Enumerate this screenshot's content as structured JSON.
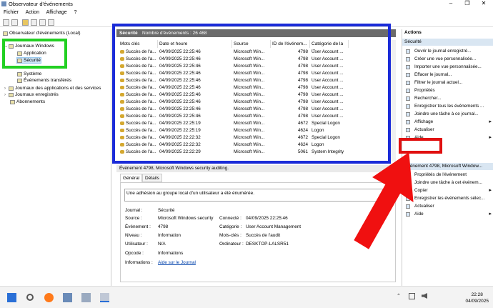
{
  "window": {
    "title": "Observateur d'événements",
    "controls": [
      "–",
      "❐",
      "✕"
    ]
  },
  "menu": [
    "Fichier",
    "Action",
    "Affichage",
    "?"
  ],
  "tree": {
    "root": "Observateur d'événements (Local)",
    "windows_logs": "Journaux Windows",
    "application": "Application",
    "security": "Sécurité",
    "system": "Système",
    "forwarded": "Événements transférés",
    "apps_services": "Journaux des applications et des services",
    "saved": "Journaux enregistrés",
    "subscriptions": "Abonnements"
  },
  "header": {
    "log": "Sécurité",
    "count": "Nombre d'événements : 26 468"
  },
  "columns": [
    "Mots clés",
    "Date et heure",
    "Source",
    "ID de l'événem...",
    "Catégorie de la ..."
  ],
  "rows": [
    [
      "Succès de l'a...",
      "04/09/2025 22:25:46",
      "Microsoft Win...",
      "4798",
      "User Account ..."
    ],
    [
      "Succès de l'a...",
      "04/09/2025 22:25:46",
      "Microsoft Win...",
      "4798",
      "User Account ..."
    ],
    [
      "Succès de l'a...",
      "04/09/2025 22:25:46",
      "Microsoft Win...",
      "4798",
      "User Account ..."
    ],
    [
      "Succès de l'a...",
      "04/09/2025 22:25:46",
      "Microsoft Win...",
      "4798",
      "User Account ..."
    ],
    [
      "Succès de l'a...",
      "04/09/2025 22:25:46",
      "Microsoft Win...",
      "4798",
      "User Account ..."
    ],
    [
      "Succès de l'a...",
      "04/09/2025 22:25:46",
      "Microsoft Win...",
      "4798",
      "User Account ..."
    ],
    [
      "Succès de l'a...",
      "04/09/2025 22:25:46",
      "Microsoft Win...",
      "4798",
      "User Account ..."
    ],
    [
      "Succès de l'a...",
      "04/09/2025 22:25:46",
      "Microsoft Win...",
      "4798",
      "User Account ..."
    ],
    [
      "Succès de l'a...",
      "04/09/2025 22:25:46",
      "Microsoft Win...",
      "4798",
      "User Account ..."
    ],
    [
      "Succès de l'a...",
      "04/09/2025 22:25:46",
      "Microsoft Win...",
      "4798",
      "User Account ..."
    ],
    [
      "Succès de l'a...",
      "04/09/2025 22:25:19",
      "Microsoft Win...",
      "4672",
      "Special Logon"
    ],
    [
      "Succès de l'a...",
      "04/09/2025 22:25:19",
      "Microsoft Win...",
      "4624",
      "Logon"
    ],
    [
      "Succès de l'a...",
      "04/09/2025 22:22:32",
      "Microsoft Win...",
      "4672",
      "Special Logon"
    ],
    [
      "Succès de l'a...",
      "04/09/2025 22:22:32",
      "Microsoft Win...",
      "4624",
      "Logon"
    ],
    [
      "Succès de l'a...",
      "04/09/2025 22:22:29",
      "Microsoft Win...",
      "5061",
      "System Integrity"
    ]
  ],
  "event_header": "Événement 4798, Microsoft Windows security auditing.",
  "tabs": [
    "Général",
    "Détails"
  ],
  "detail": {
    "message": "Une adhésion au groupe local d'un utilisateur a été énumérée.",
    "journal_lbl": "Journal :",
    "journal": "Sécurité",
    "source_lbl": "Source :",
    "source": "Microsoft Windows security",
    "connecte_lbl": "Connecté :",
    "connecte": "04/09/2025 22:25:46",
    "evenement_lbl": "Événement :",
    "evenement": "4798",
    "categorie_lbl": "Catégorie :",
    "categorie": "User Account Management",
    "niveau_lbl": "Niveau :",
    "niveau": "Information",
    "motscles_lbl": "Mots-clés :",
    "motscles": "Succès de l'audit",
    "utilisateur_lbl": "Utilisateur :",
    "utilisateur": "N/A",
    "ordinateur_lbl": "Ordinateur :",
    "ordinateur": "DESKTOP-LALSR51",
    "opcode_lbl": "Opcode :",
    "opcode": "Informations",
    "info_lbl": "Informations :",
    "info_link": "Aide sur le Journal"
  },
  "actions": {
    "title": "Actions",
    "section1": "Sécurité",
    "items1": [
      "Ouvrir le journal enregistré...",
      "Créer une vue personnalisée...",
      "Importer une vue personnalisée...",
      "Effacer le journal...",
      "Filtrer le journal actuel...",
      "Propriétés",
      "Rechercher...",
      "Enregistrer tous les événements ...",
      "Joindre une tâche à ce journal...",
      "Affichage",
      "Actualiser",
      "Aide"
    ],
    "section2": "Événement 4798, Microsoft Window...",
    "items2": [
      "Propriétés de l'événement",
      "Joindre une tâche à cet événem...",
      "Copier",
      "Enregistrer les événements sélec...",
      "Actualiser",
      "Aide"
    ]
  },
  "clock": {
    "time": "22:28",
    "date": "04/09/2025"
  }
}
